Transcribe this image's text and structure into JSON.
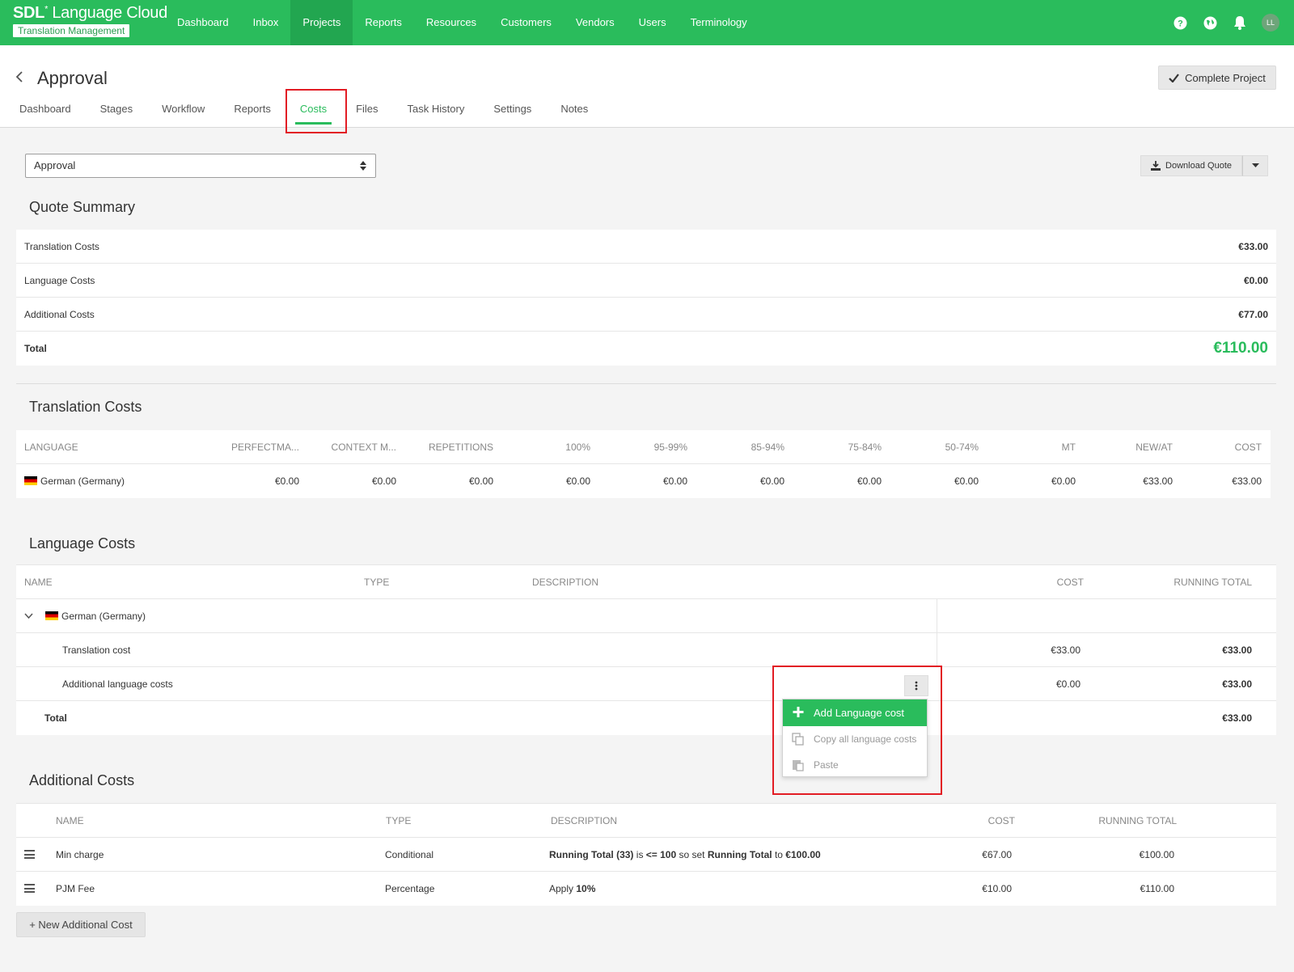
{
  "app": {
    "logo_brand": "SDL",
    "logo_product": "Language Cloud",
    "logo_sub": "Translation Management",
    "avatar_initials": "LL",
    "accent_color": "#2abc5c"
  },
  "nav": [
    "Dashboard",
    "Inbox",
    "Projects",
    "Reports",
    "Resources",
    "Customers",
    "Vendors",
    "Users",
    "Terminology"
  ],
  "nav_active": "Projects",
  "page": {
    "title": "Approval",
    "complete_label": "Complete Project",
    "tabs": [
      "Dashboard",
      "Stages",
      "Workflow",
      "Reports",
      "Costs",
      "Files",
      "Task History",
      "Settings",
      "Notes"
    ],
    "active_tab": "Costs"
  },
  "filter": {
    "selected": "Approval"
  },
  "download_label": "Download Quote",
  "quote_summary": {
    "title": "Quote Summary",
    "rows": [
      {
        "label": "Translation Costs",
        "value": "€33.00"
      },
      {
        "label": "Language Costs",
        "value": "€0.00"
      },
      {
        "label": "Additional Costs",
        "value": "€77.00"
      }
    ],
    "total_label": "Total",
    "total_value": "€110.00"
  },
  "translation_costs": {
    "title": "Translation Costs",
    "headers": [
      "LANGUAGE",
      "PERFECTMA...",
      "CONTEXT M...",
      "REPETITIONS",
      "100%",
      "95-99%",
      "85-94%",
      "75-84%",
      "50-74%",
      "MT",
      "NEW/AT",
      "COST"
    ],
    "row": {
      "language": "German (Germany)",
      "values": [
        "€0.00",
        "€0.00",
        "€0.00",
        "€0.00",
        "€0.00",
        "€0.00",
        "€0.00",
        "€0.00",
        "€0.00",
        "€33.00",
        "€33.00"
      ]
    }
  },
  "language_costs": {
    "title": "Language Costs",
    "headers": [
      "NAME",
      "TYPE",
      "DESCRIPTION",
      "COST",
      "RUNNING TOTAL"
    ],
    "group": "German (Germany)",
    "rows": [
      {
        "name": "Translation cost",
        "cost": "€33.00",
        "running": "€33.00"
      },
      {
        "name": "Additional language costs",
        "cost": "€0.00",
        "running": "€33.00"
      }
    ],
    "total_label": "Total",
    "total_value": "€33.00"
  },
  "context_menu": {
    "add": "Add Language cost",
    "copy": "Copy all language costs",
    "paste": "Paste"
  },
  "additional_costs": {
    "title": "Additional Costs",
    "headers": [
      "NAME",
      "TYPE",
      "DESCRIPTION",
      "COST",
      "RUNNING TOTAL"
    ],
    "rows": [
      {
        "name": "Min charge",
        "type": "Conditional",
        "desc_parts": [
          "Running Total (33)",
          " is ",
          "<= 100",
          " so set ",
          "Running Total",
          " to ",
          "€100.00"
        ],
        "cost": "€67.00",
        "running": "€100.00"
      },
      {
        "name": "PJM Fee",
        "type": "Percentage",
        "desc_parts": [
          "Apply ",
          "10%"
        ],
        "cost": "€10.00",
        "running": "€110.00"
      }
    ],
    "new_label": "+ New Additional Cost"
  }
}
